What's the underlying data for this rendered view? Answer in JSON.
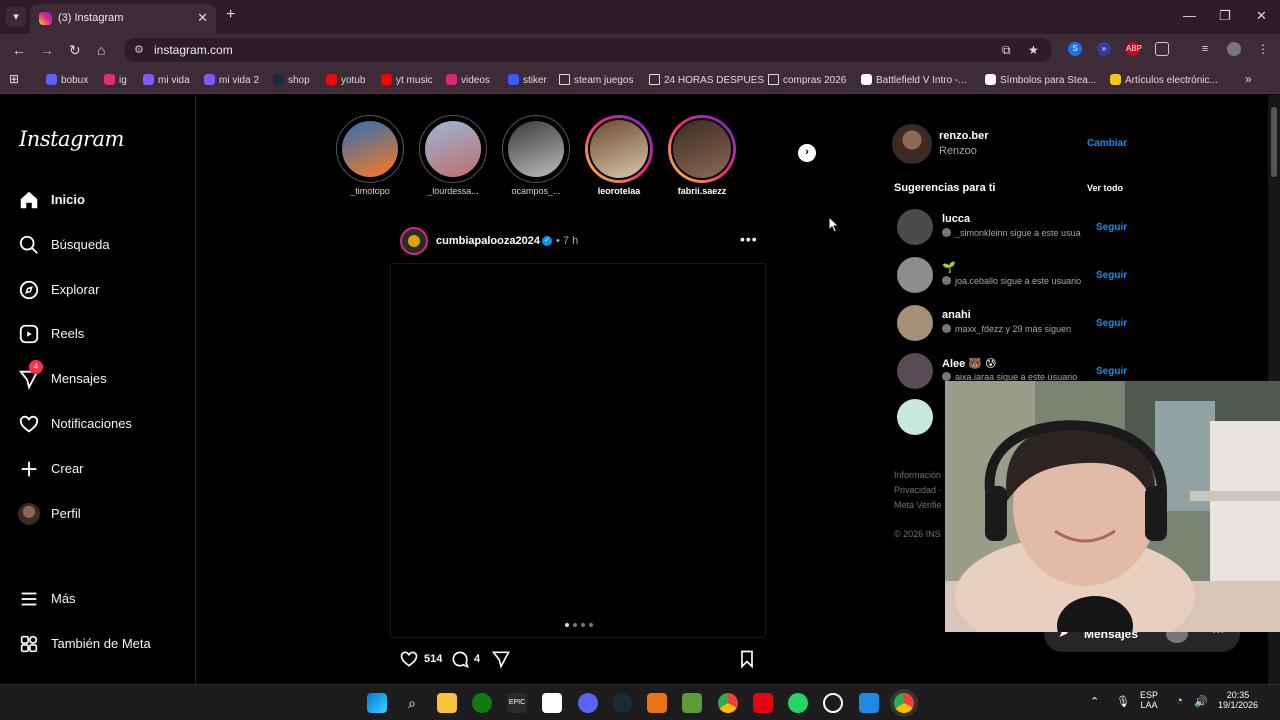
{
  "browser": {
    "tab_title": "(3) Instagram",
    "url": "instagram.com",
    "bookmarks": [
      {
        "label": "bobux",
        "color": "#5865f2"
      },
      {
        "label": "ig",
        "color": "#e1306c"
      },
      {
        "label": "mi vida",
        "color": "#7b5cff"
      },
      {
        "label": "mi vida 2",
        "color": "#7b5cff"
      },
      {
        "label": "shop",
        "color": "#1b2838"
      },
      {
        "label": "yotub",
        "color": "#ff0000"
      },
      {
        "label": "yt music",
        "color": "#ff0000"
      },
      {
        "label": "videos",
        "color": "#d62976"
      },
      {
        "label": "stiker",
        "color": "#3a5cff"
      },
      {
        "label": "steam juegos",
        "color": "folder"
      },
      {
        "label": "24 HORAS DESPUES",
        "color": "folder"
      },
      {
        "label": "compras 2026",
        "color": "folder"
      },
      {
        "label": "Battlefield V Intro -...",
        "color": "#ffffff"
      },
      {
        "label": "Símbolos para Stea...",
        "color": "#ffffff"
      },
      {
        "label": "Artículos electrónic...",
        "color": "#f5c518"
      }
    ]
  },
  "sidebar": {
    "logo": "Instagram",
    "items": [
      {
        "label": "Inicio",
        "icon": "home-icon"
      },
      {
        "label": "Búsqueda",
        "icon": "search-icon"
      },
      {
        "label": "Explorar",
        "icon": "compass-icon"
      },
      {
        "label": "Reels",
        "icon": "reels-icon"
      },
      {
        "label": "Mensajes",
        "icon": "messenger-icon",
        "badge": "4"
      },
      {
        "label": "Notificaciones",
        "icon": "heart-icon"
      },
      {
        "label": "Crear",
        "icon": "plus-icon"
      },
      {
        "label": "Perfil",
        "icon": "avatar"
      }
    ],
    "more": "Más",
    "meta": "También de Meta"
  },
  "stories": [
    {
      "name": "_timotopo",
      "seen": true,
      "colors": [
        "#2b6fb8",
        "#ff7a1a"
      ]
    },
    {
      "name": "_lourdessa...",
      "seen": true,
      "colors": [
        "#9bb7d6",
        "#c06d6d"
      ]
    },
    {
      "name": "ocampos_...",
      "seen": true,
      "colors": [
        "#3a3a3a",
        "#bdbdbd"
      ]
    },
    {
      "name": "leorotelaa",
      "seen": false,
      "colors": [
        "#6b4b33",
        "#d8c7a8"
      ]
    },
    {
      "name": "fabrii.saezz",
      "seen": false,
      "colors": [
        "#3c2b22",
        "#8a6a55"
      ]
    }
  ],
  "post": {
    "username": "cumbiapalooza2024",
    "time": "• 7 h",
    "likes": "514",
    "comments": "4"
  },
  "right": {
    "username": "renzo.ber",
    "fullname": "Renzoo",
    "switch": "Cambiar",
    "suggestions_title": "Sugerencias para ti",
    "see_all": "Ver todo",
    "suggestions": [
      {
        "user": "lucca",
        "sub": "_simonkleinn sigue a este usua",
        "follow": "Seguir",
        "color": "#4a4a4a"
      },
      {
        "user": "🌱",
        "sub": "joa.ceballo sigue a este usuario",
        "follow": "Seguir",
        "color": "#8d8d8d"
      },
      {
        "user": "anahi",
        "sub": "maxx_fdezz y 29 más siguen",
        "follow": "Seguir",
        "color": "#a88f7a"
      },
      {
        "user": "Alee 🐻 😰",
        "sub": "aixa.iaraa sigue a este usuario",
        "follow": "Seguir",
        "color": "#5a4a55"
      },
      {
        "user": "",
        "sub": "",
        "follow": "",
        "color": "#c9e8dc"
      }
    ],
    "footer": [
      "Información",
      "Privacidad ·",
      "Meta Verifie",
      "© 2026 INS"
    ]
  },
  "messages_pill": "Mensajes",
  "taskbar": {
    "lang": "ESP",
    "layout": "LAA",
    "time": "20:35",
    "date": "19/1/2026"
  }
}
